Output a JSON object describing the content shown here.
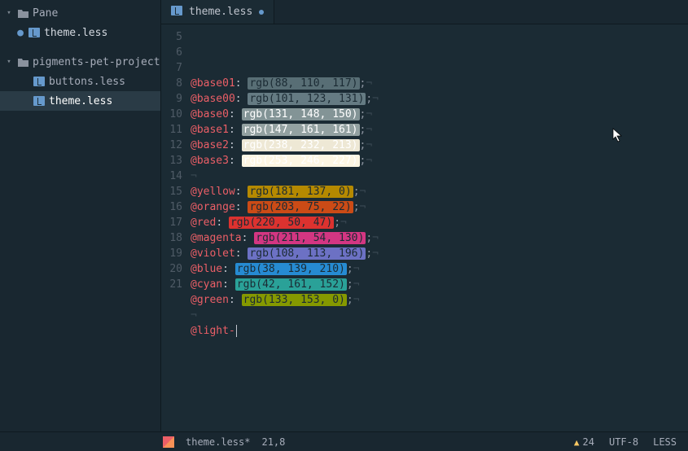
{
  "sidebar": {
    "project1": {
      "name": "Pane",
      "expanded": true
    },
    "project1_file": {
      "name": "theme.less",
      "modified": true
    },
    "project2": {
      "name": "pigments-pet-project",
      "expanded": true
    },
    "project2_files": [
      {
        "name": "buttons.less"
      },
      {
        "name": "theme.less",
        "selected": true
      }
    ]
  },
  "tab": {
    "title": "theme.less",
    "modified": true
  },
  "lines": [
    {
      "n": 5,
      "var": "@base01",
      "val": "rgb(88, 110, 117)",
      "bg": "#586e75",
      "text": "light"
    },
    {
      "n": 6,
      "var": "@base00",
      "val": "rgb(101, 123, 131)",
      "bg": "#657b83",
      "text": "light"
    },
    {
      "n": 7,
      "var": "@base0",
      "val": "rgb(131, 148, 150)",
      "bg": "#839496",
      "text": "dark"
    },
    {
      "n": 8,
      "var": "@base1",
      "val": "rgb(147, 161, 161)",
      "bg": "#93a1a1",
      "text": "dark"
    },
    {
      "n": 9,
      "var": "@base2",
      "val": "rgb(238, 232, 213)",
      "bg": "#eee8d5",
      "text": "dark"
    },
    {
      "n": 10,
      "var": "@base3",
      "val": "rgb(253, 246, 227)",
      "bg": "#fdf6e3",
      "text": "dark"
    },
    {
      "n": 11
    },
    {
      "n": 12,
      "var": "@yellow",
      "val": "rgb(181, 137, 0)",
      "bg": "#b58900",
      "text": "light"
    },
    {
      "n": 13,
      "var": "@orange",
      "val": "rgb(203, 75, 22)",
      "bg": "#cb4b16",
      "text": "light"
    },
    {
      "n": 14,
      "var": "@red",
      "val": "rgb(220, 50, 47)",
      "bg": "#dc322f",
      "text": "light"
    },
    {
      "n": 15,
      "var": "@magenta",
      "val": "rgb(211, 54, 130)",
      "bg": "#d33682",
      "text": "light"
    },
    {
      "n": 16,
      "var": "@violet",
      "val": "rgb(108, 113, 196)",
      "bg": "#6c71c4",
      "text": "light"
    },
    {
      "n": 17,
      "var": "@blue",
      "val": "rgb(38, 139, 210)",
      "bg": "#268bd2",
      "text": "light"
    },
    {
      "n": 18,
      "var": "@cyan",
      "val": "rgb(42, 161, 152)",
      "bg": "#2aa198",
      "text": "light"
    },
    {
      "n": 19,
      "var": "@green",
      "val": "rgb(133, 153, 0)",
      "bg": "#859900",
      "text": "light"
    },
    {
      "n": 20
    },
    {
      "n": 21,
      "raw_var": "@light-",
      "cursor": true
    }
  ],
  "status": {
    "filename": "theme.less*",
    "position": "21,8",
    "warnings": "24",
    "encoding": "UTF-8",
    "grammar": "LESS"
  }
}
